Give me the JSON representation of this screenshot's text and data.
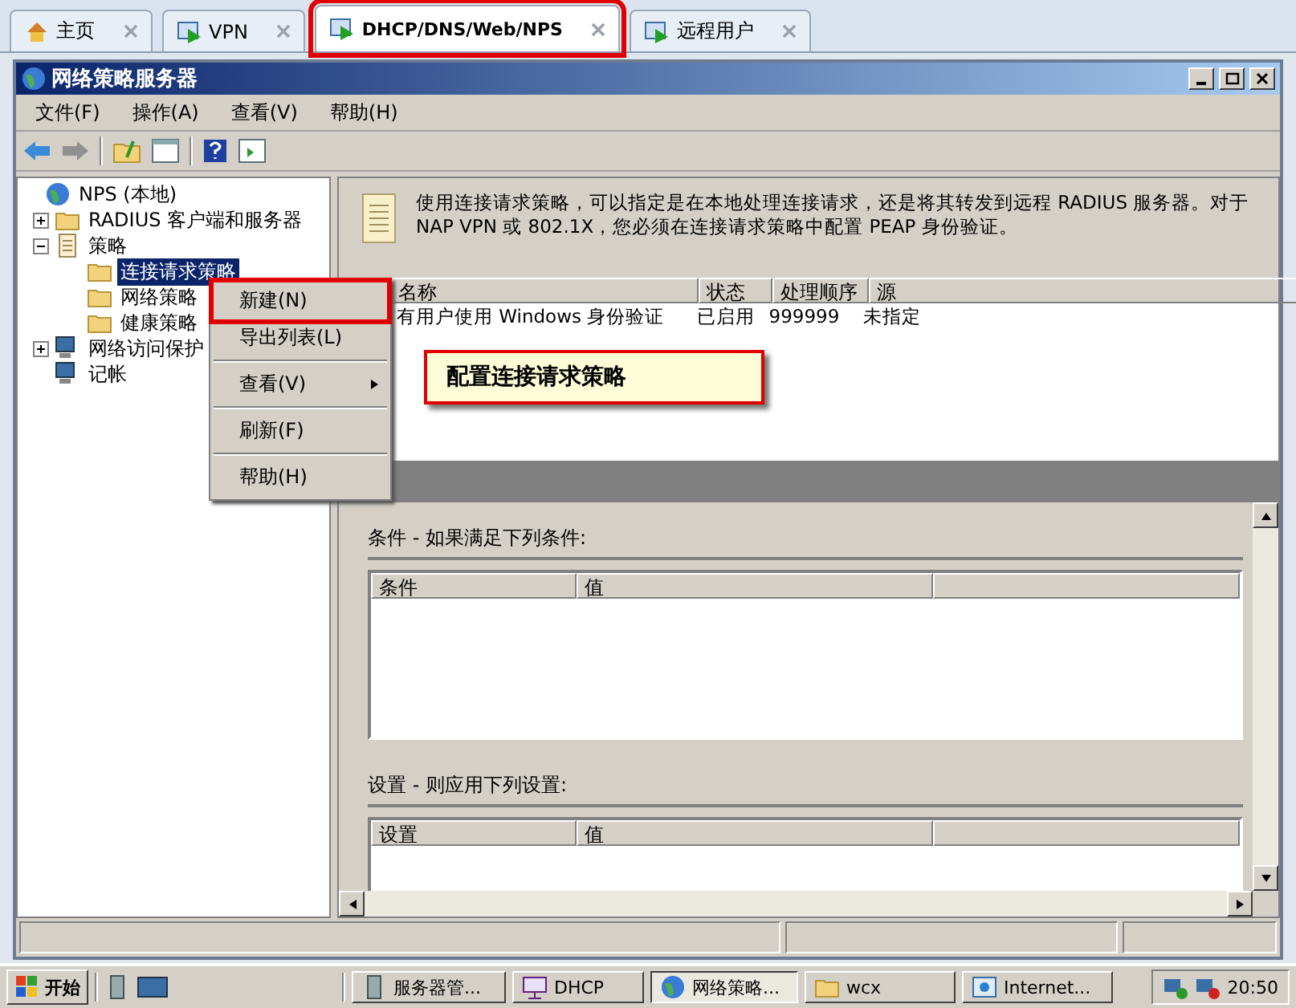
{
  "browser_tabs": [
    {
      "label": "主页",
      "kind": "home",
      "selected": false,
      "annotated": false
    },
    {
      "label": "VPN",
      "kind": "console",
      "selected": false,
      "annotated": false
    },
    {
      "label": "DHCP/DNS/Web/NPS",
      "kind": "console",
      "selected": true,
      "annotated": true
    },
    {
      "label": "远程用户",
      "kind": "console",
      "selected": false,
      "annotated": false
    }
  ],
  "window": {
    "title": "网络策略服务器"
  },
  "menu": [
    "文件(F)",
    "操作(A)",
    "查看(V)",
    "帮助(H)"
  ],
  "tree": [
    {
      "label": "NPS (本地)",
      "kind": "globe",
      "selected": false,
      "children": [
        {
          "label": "RADIUS 客户端和服务器",
          "kind": "folder",
          "selected": false,
          "expanded": false
        },
        {
          "label": "策略",
          "kind": "scroll",
          "selected": false,
          "expanded": true,
          "children": [
            {
              "label": "连接请求策略",
              "kind": "folder",
              "selected": true
            },
            {
              "label": "网络策略",
              "kind": "folder",
              "selected": false
            },
            {
              "label": "健康策略",
              "kind": "folder",
              "selected": false
            }
          ]
        },
        {
          "label": "网络访问保护",
          "kind": "computer",
          "selected": false,
          "expanded": false
        },
        {
          "label": "记帐",
          "kind": "computer",
          "selected": false
        }
      ]
    }
  ],
  "description": "使用连接请求策略，可以指定是在本地处理连接请求，还是将其转发到远程 RADIUS 服务器。对于 NAP VPN 或 802.1X，您必须在连接请求策略中配置 PEAP 身份验证。",
  "policy_table": {
    "columns": [
      "名称",
      "状态",
      "处理顺序",
      "源"
    ],
    "rows": [
      [
        "有用户使用  Windows 身份验证",
        "已启用",
        "999999",
        "未指定"
      ]
    ]
  },
  "conditions": {
    "heading": "条件 - 如果满足下列条件:",
    "columns": [
      "条件",
      "值"
    ]
  },
  "settings": {
    "heading": "设置 - 则应用下列设置:",
    "columns": [
      "设置",
      "值"
    ]
  },
  "context_menu": [
    {
      "kind": "item",
      "label": "新建(N)",
      "annotated": true,
      "submenu": false
    },
    {
      "kind": "item",
      "label": "导出列表(L)",
      "annotated": false,
      "submenu": false
    },
    {
      "kind": "separator"
    },
    {
      "kind": "item",
      "label": "查看(V)",
      "annotated": false,
      "submenu": true
    },
    {
      "kind": "separator"
    },
    {
      "kind": "item",
      "label": "刷新(F)",
      "annotated": false,
      "submenu": false
    },
    {
      "kind": "separator"
    },
    {
      "kind": "item",
      "label": "帮助(H)",
      "annotated": false,
      "submenu": false
    }
  ],
  "callout": "配置连接请求策略",
  "taskbar": {
    "start": "开始",
    "buttons": [
      {
        "label": "服务器管...",
        "kind": "server",
        "selected": false
      },
      {
        "label": "DHCP",
        "kind": "dhcp",
        "selected": false
      },
      {
        "label": "网络策略...",
        "kind": "globe",
        "selected": true
      },
      {
        "label": "wcx",
        "kind": "folder",
        "selected": false
      },
      {
        "label": "Internet...",
        "kind": "ie",
        "selected": false
      }
    ],
    "clock": "20:50"
  }
}
